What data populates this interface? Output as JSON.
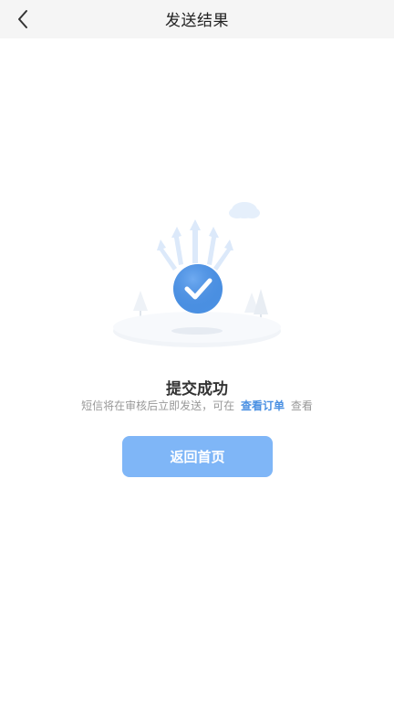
{
  "nav": {
    "title": "发送结果"
  },
  "result": {
    "title": "提交成功",
    "desc_prefix": "短信将在审核后立即发送，可在",
    "desc_link": "查看订单",
    "desc_suffix": "查看"
  },
  "actions": {
    "home_label": "返回首页"
  },
  "colors": {
    "accent": "#4a90e2",
    "button": "#7fb6f7",
    "nav_bg": "#f5f5f5"
  },
  "icons": {
    "back": "chevron-left-icon",
    "success": "check-circle-icon"
  }
}
